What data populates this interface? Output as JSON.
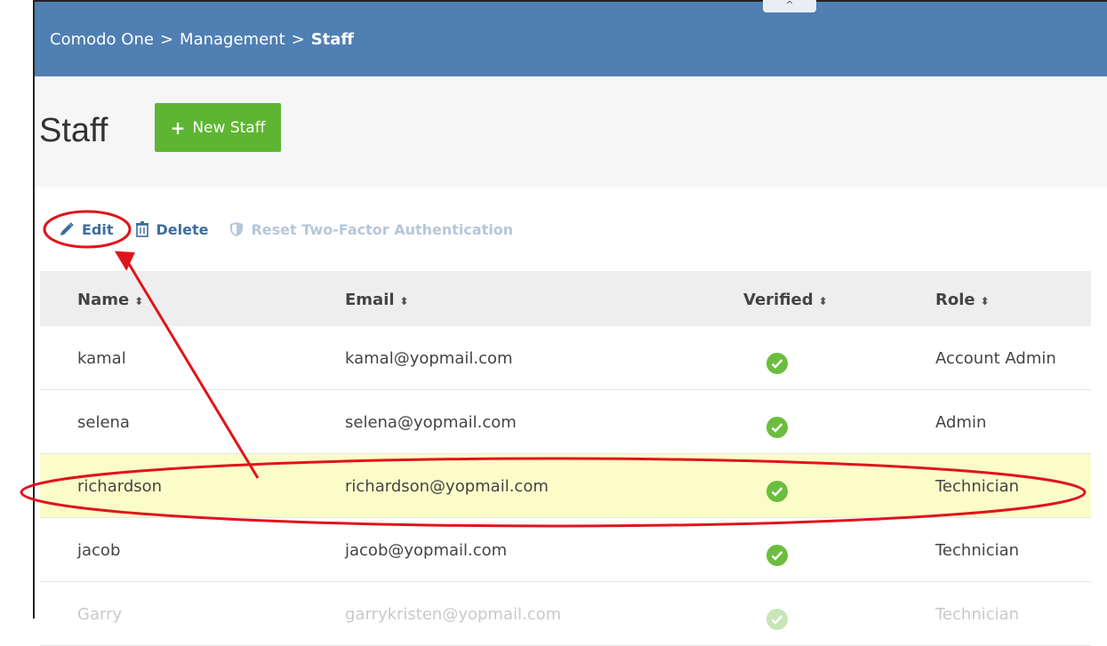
{
  "topbar": {
    "collapse_glyph": "^",
    "breadcrumb": [
      "Comodo One",
      "Management",
      "Staff"
    ],
    "separator": ">"
  },
  "page": {
    "title": "Staff",
    "new_button": "New Staff",
    "new_button_icon": "plus-icon"
  },
  "toolbar": {
    "edit": "Edit",
    "delete": "Delete",
    "reset_2fa": "Reset Two-Factor Authentication"
  },
  "table": {
    "headers": {
      "name": "Name",
      "email": "Email",
      "verified": "Verified",
      "role": "Role"
    },
    "sort_glyph": "⬍",
    "rows": [
      {
        "name": "kamal",
        "email": "kamal@yopmail.com",
        "verified": true,
        "role": "Account Admin"
      },
      {
        "name": "selena",
        "email": "selena@yopmail.com",
        "verified": true,
        "role": "Admin"
      },
      {
        "name": "richardson",
        "email": "richardson@yopmail.com",
        "verified": true,
        "role": "Technician",
        "selected": true
      },
      {
        "name": "jacob",
        "email": "jacob@yopmail.com",
        "verified": true,
        "role": "Technician"
      },
      {
        "name": "Garry",
        "email": "garrykristen@yopmail.com",
        "verified": true,
        "role": "Technician"
      }
    ]
  },
  "colors": {
    "topbar": "#4f7fb3",
    "accent_green": "#5eb531",
    "link_blue": "#3e6d9c",
    "highlight_row": "#fbfdc9",
    "annotation_red": "#e0141b"
  }
}
